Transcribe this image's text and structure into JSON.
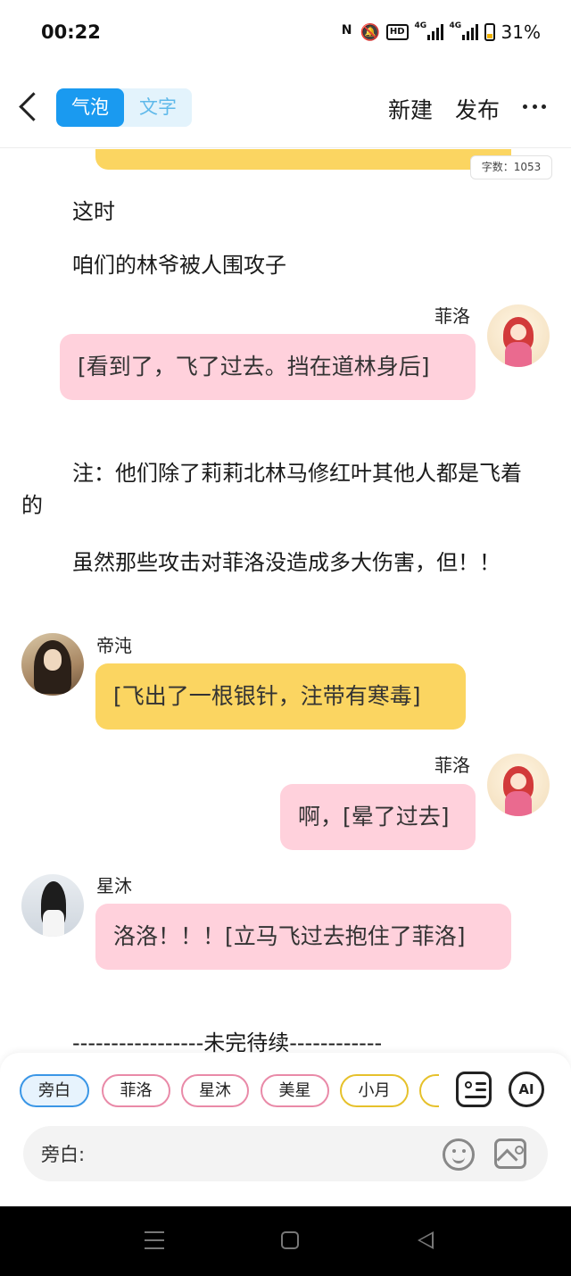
{
  "status_bar": {
    "time": "00:22",
    "nfc": "N",
    "hd": "HD",
    "net1": "4G",
    "net2": "4G",
    "battery": "31%"
  },
  "header": {
    "tabs": [
      {
        "label": "气泡",
        "active": true
      },
      {
        "label": "文字",
        "active": false
      }
    ],
    "new_label": "新建",
    "publish_label": "发布"
  },
  "word_count": "字数：1053",
  "story": [
    {
      "type": "narration",
      "text": "这时"
    },
    {
      "type": "narration",
      "text": "咱们的林爷被人围攻子"
    },
    {
      "type": "dialogue",
      "speaker": "菲洛",
      "text": "[看到了，飞了过去。挡在道林身后]"
    },
    {
      "type": "narration",
      "text": "注：他们除了莉莉北林马修红叶其他人都是飞着的"
    },
    {
      "type": "narration",
      "text": "虽然那些攻击对菲洛没造成多大伤害，但！！"
    },
    {
      "type": "dialogue",
      "speaker": "帝沌",
      "text": "[飞出了一根银针，注带有寒毒]"
    },
    {
      "type": "dialogue",
      "speaker": "菲洛",
      "text": "啊，[晕了过去]"
    },
    {
      "type": "dialogue",
      "speaker": "星沐",
      "text": "洛洛！！！[立马飞过去抱住了菲洛]"
    },
    {
      "type": "narration",
      "text": "-----------------未完待续------------"
    }
  ],
  "characters": [
    {
      "name": "旁白",
      "color": "#3a96e6"
    },
    {
      "name": "菲洛",
      "color": "#e98aa8"
    },
    {
      "name": "星沐",
      "color": "#e98aa8"
    },
    {
      "name": "美星",
      "color": "#e98aa8"
    },
    {
      "name": "小月",
      "color": "#e6c12b"
    }
  ],
  "composer": {
    "speaker_label": "旁白:",
    "value": "",
    "ai_label": "AI"
  },
  "icons": {
    "back": "back-arrow-icon",
    "more": "more-icon",
    "role_manage": "role-card-icon",
    "emoji": "emoji-icon",
    "image": "image-icon"
  }
}
